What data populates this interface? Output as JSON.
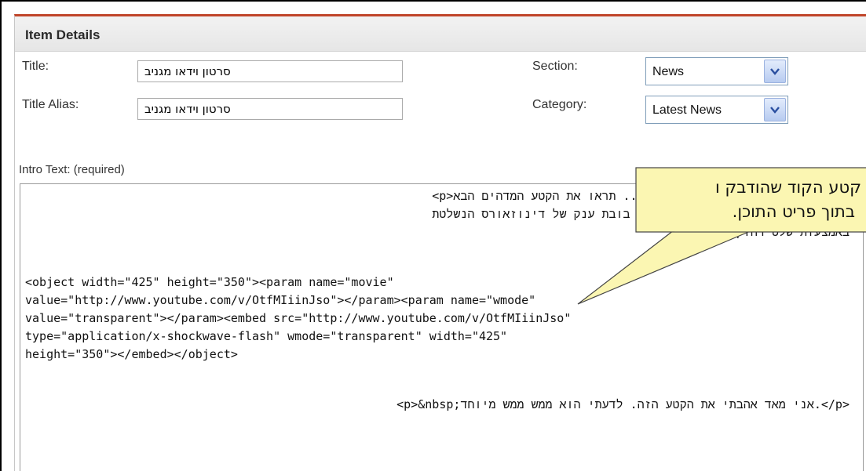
{
  "panel": {
    "title": "Item Details"
  },
  "form": {
    "title_label": "Title:",
    "title_value": "סרטון וידאו מגניב",
    "alias_label": "Title Alias:",
    "alias_value": "סרטון וידאו מגניב",
    "section_label": "Section:",
    "section_value": "News",
    "category_label": "Category:",
    "category_value": "Latest News",
    "intro_label": "Intro Text: (required)"
  },
  "intro_text": {
    "lines": [
      "<p>היי.. תראו את הקטע המדהים הבא!!!<br /> דינוזאורים לדעת, ",
      "קיימים באמת</strong>, בנייה של בובת ענק של דינוזאורס הנשלטת ",
      "באמצעות שלט רחוק.</p>",
      "",
      "<object width=\"425\" height=\"350\"><param name=\"movie\"",
      "value=\"http://www.youtube.com/v/OtfMIiinJso\"></param><param name=\"wmode\"",
      "value=\"transparent\"></param><embed src=\"http://www.youtube.com/v/OtfMIiinJso\"",
      "type=\"application/x-shockwave-flash\" wmode=\"transparent\" width=\"425\"",
      "height=\"350\"></embed></object>",
      "",
      "<p>&nbsp;אני מאד אהבתי את הקטע הזה. לדעתי הוא ממש ממש מיוחד.</p>"
    ]
  },
  "callout": {
    "line1": "קטע הקוד שהודבק ו",
    "line2": "בתוך פריט התוכן."
  },
  "colors": {
    "accent": "#c0452a",
    "callout_bg": "#ffffc0"
  }
}
